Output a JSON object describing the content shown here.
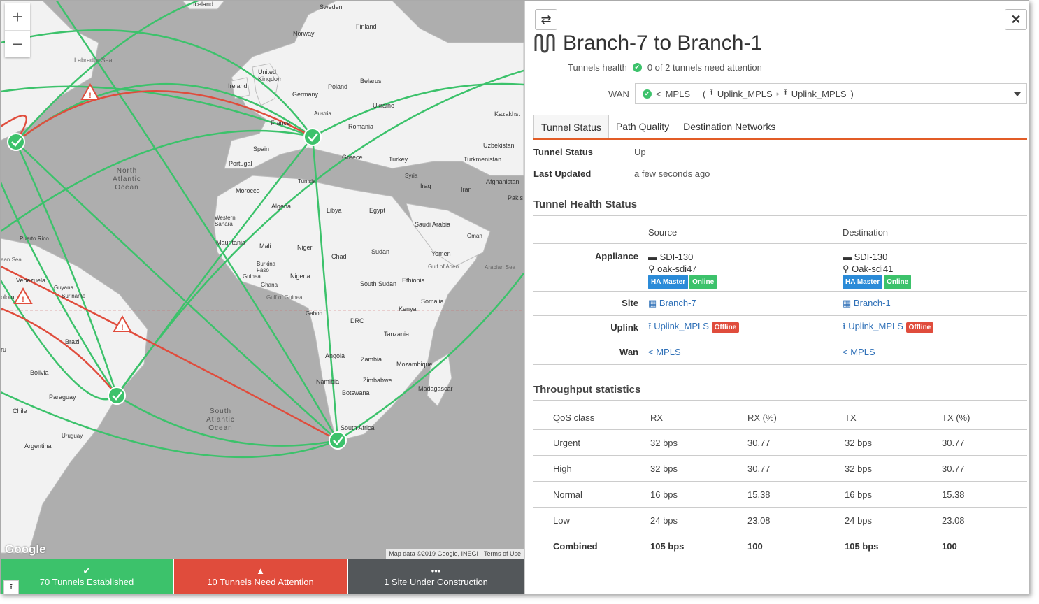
{
  "map": {
    "zoom_in": "+",
    "zoom_out": "−",
    "google_logo": "Google",
    "attribution": "Map data ©2019 Google, INEGI",
    "terms": "Terms of Use",
    "labels": {
      "iceland": "Iceland",
      "sweden": "Sweden",
      "finland": "Finland",
      "norway": "Norway",
      "labrador_sea": "Labrador Sea",
      "united_kingdom": "United Kingdom",
      "ireland": "Ireland",
      "poland": "Poland",
      "belarus": "Belarus",
      "germany": "Germany",
      "ukraine": "Ukraine",
      "austria": "Austria",
      "kazakhstan": "Kazakhst",
      "france": "France",
      "romania": "Romania",
      "spain": "Spain",
      "uzbekistan": "Uzbekistan",
      "portugal": "Portugal",
      "greece": "Greece",
      "turkey": "Turkey",
      "turkmenistan": "Turkmenistan",
      "syria": "Syria",
      "afghanistan": "Afghanistan",
      "iraq": "Iraq",
      "iran": "Iran",
      "tunisia": "Tunisia",
      "morocco": "Morocco",
      "pakistan": "Pakis",
      "algeria": "Algeria",
      "libya": "Libya",
      "egypt": "Egypt",
      "western_sahara": "Western Sahara",
      "saudi_arabia": "Saudi Arabia",
      "oman": "Oman",
      "mauritania": "Mauritania",
      "mali": "Mali",
      "niger": "Niger",
      "chad": "Chad",
      "sudan": "Sudan",
      "yemen": "Yemen",
      "puerto_rico": "Puerto Rico",
      "gulf_aden": "Gulf of Aden",
      "arabian_sea": "Arabian Sea",
      "burkina": "Burkina Faso",
      "venezuela": "Venezuela",
      "guyana": "Guyana",
      "suriname": "Suriname",
      "guinea": "Guinea",
      "ghana": "Ghana",
      "nigeria": "Nigeria",
      "south_sudan": "South Sudan",
      "ethiopia": "Ethiopia",
      "somalia": "Somalia",
      "colombia": "olom",
      "gulf_guinea": "Gulf of Guinea",
      "gabon": "Gabon",
      "kenya": "Kenya",
      "drc": "DRC",
      "tanzania": "Tanzania",
      "brazil": "Brazil",
      "peru": "ru",
      "angola": "Angola",
      "zambia": "Zambia",
      "mozambique": "Mozambique",
      "bolivia": "Bolivia",
      "namibia": "Namibia",
      "zimbabwe": "Zimbabwe",
      "madagascar": "Madagascar",
      "paraguay": "Paraguay",
      "botswana": "Botswana",
      "chile": "Chile",
      "uruguay": "Uruguay",
      "south_africa": "South Africa",
      "argentina": "Argentina",
      "caribbean": "ean Sea"
    },
    "oceans": {
      "north_atlantic": "North Atlantic Ocean",
      "south_atlantic": "South Atlantic Ocean"
    },
    "colors": {
      "ok": "#3cc26b",
      "alert": "#e04c3c"
    }
  },
  "status_bar": {
    "established": "70 Tunnels Established",
    "attention": "10 Tunnels Need Attention",
    "construction": "1 Site Under Construction"
  },
  "panel": {
    "title": "Branch-7 to Branch-1",
    "health_label": "Tunnels health",
    "health_value": "0 of 2 tunnels need attention",
    "wan_label": "WAN",
    "wan_name": "MPLS",
    "wan_uplink_src": "Uplink_MPLS",
    "wan_uplink_dst": "Uplink_MPLS",
    "tabs": [
      "Tunnel Status",
      "Path Quality",
      "Destination Networks"
    ],
    "tunnel_status_label": "Tunnel Status",
    "tunnel_status_value": "Up",
    "last_updated_label": "Last Updated",
    "last_updated_value": "a few seconds ago",
    "health_section": "Tunnel Health Status",
    "health_table": {
      "col_source": "Source",
      "col_destination": "Destination",
      "row_appliance": "Appliance",
      "row_site": "Site",
      "row_uplink": "Uplink",
      "row_wan": "Wan",
      "source": {
        "appliance": "SDI-130",
        "host": "oak-sdi47",
        "ha": "HA Master",
        "state": "Online",
        "site": "Branch-7",
        "uplink": "Uplink_MPLS",
        "uplink_state": "Offline",
        "wan": "MPLS"
      },
      "destination": {
        "appliance": "SDI-130",
        "host": "Oak-sdi41",
        "ha": "HA Master",
        "state": "Online",
        "site": "Branch-1",
        "uplink": "Uplink_MPLS",
        "uplink_state": "Offline",
        "wan": "MPLS"
      }
    },
    "throughput_section": "Throughput statistics",
    "throughput": {
      "headers": [
        "QoS class",
        "RX",
        "RX (%)",
        "TX",
        "TX (%)"
      ],
      "rows": [
        [
          "Urgent",
          "32 bps",
          "30.77",
          "32 bps",
          "30.77"
        ],
        [
          "High",
          "32 bps",
          "30.77",
          "32 bps",
          "30.77"
        ],
        [
          "Normal",
          "16 bps",
          "15.38",
          "16 bps",
          "15.38"
        ],
        [
          "Low",
          "24 bps",
          "23.08",
          "24 bps",
          "23.08"
        ],
        [
          "Combined",
          "105 bps",
          "100",
          "105 bps",
          "100"
        ]
      ]
    }
  }
}
